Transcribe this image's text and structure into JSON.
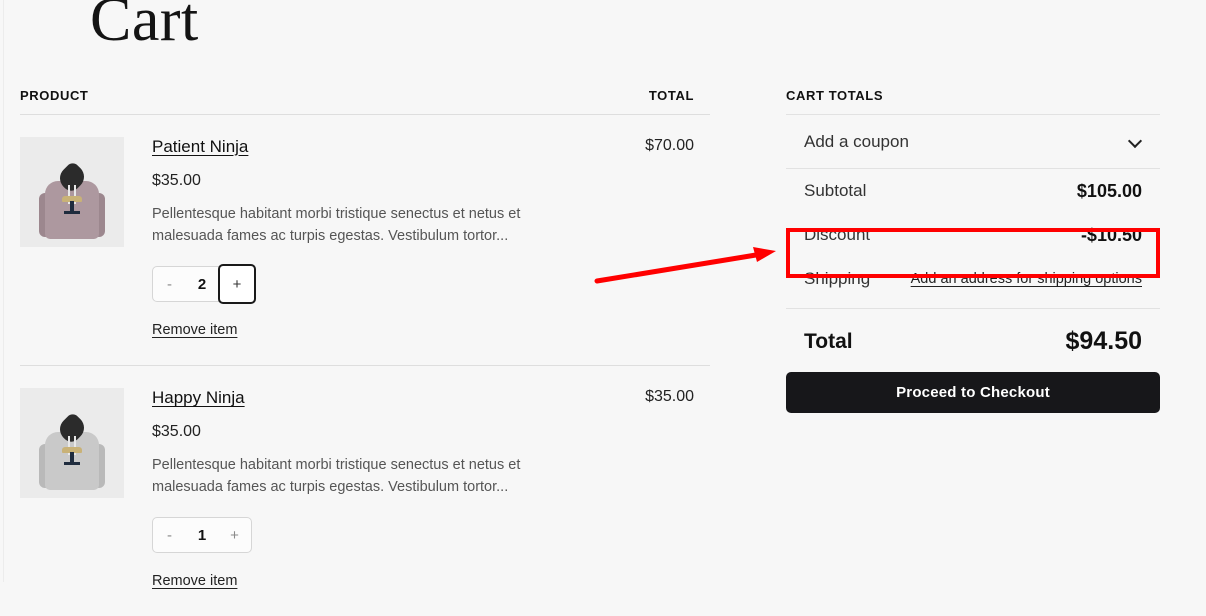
{
  "page": {
    "title": "Cart",
    "background_color": "#f7f7f7"
  },
  "product_table": {
    "headers": {
      "product": "PRODUCT",
      "total": "TOTAL"
    },
    "items": [
      {
        "name": "Patient Ninja",
        "unit_price": "$35.00",
        "description": "Pellentesque habitant morbi tristique senectus et netus et malesuada fames ac turpis egestas. Vestibulum tortor...",
        "quantity": "2",
        "decrement_label": "-",
        "increment_label": "+",
        "remove_label": "Remove item",
        "line_total": "$70.00",
        "thumbnail_color": "#a8939a",
        "increment_focused": true
      },
      {
        "name": "Happy Ninja",
        "unit_price": "$35.00",
        "description": "Pellentesque habitant morbi tristique senectus et netus et malesuada fames ac turpis egestas. Vestibulum tortor...",
        "quantity": "1",
        "decrement_label": "-",
        "increment_label": "+",
        "remove_label": "Remove item",
        "line_total": "$35.00",
        "thumbnail_color": "#c7c7c7",
        "increment_focused": false
      }
    ]
  },
  "cart_totals": {
    "heading": "CART TOTALS",
    "coupon_label": "Add a coupon",
    "subtotal_label": "Subtotal",
    "subtotal_value": "$105.00",
    "discount_label": "Discount",
    "discount_value": "-$10.50",
    "shipping_label": "Shipping",
    "shipping_value": "Add an address for shipping options",
    "total_label": "Total",
    "total_value": "$94.50",
    "checkout_label": "Proceed to Checkout"
  },
  "annotation": {
    "highlight_color": "#ff0000",
    "highlight_target": "Discount"
  }
}
